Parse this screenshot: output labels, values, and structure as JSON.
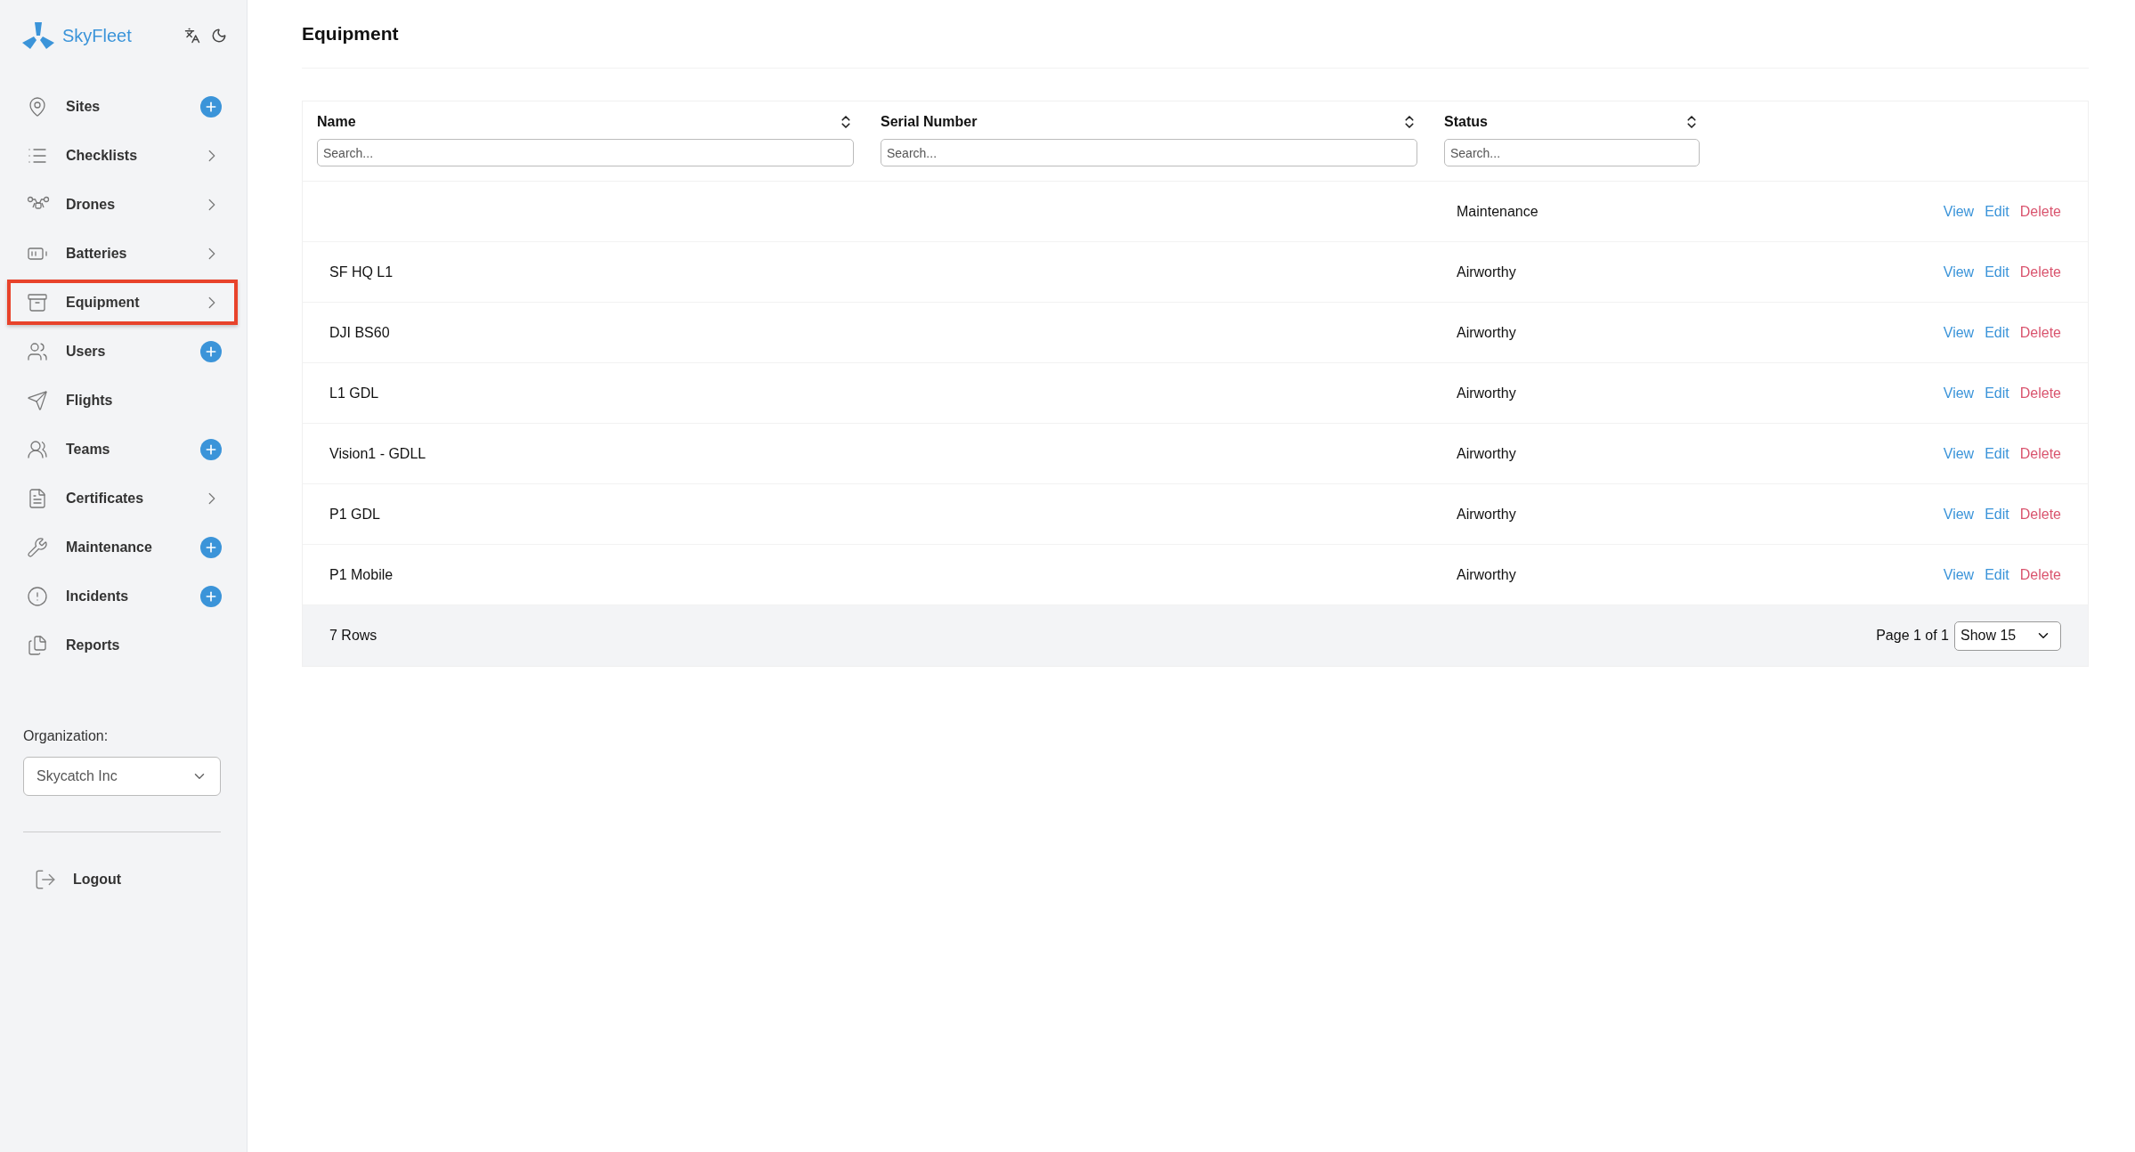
{
  "brand": {
    "name": "SkyFleet"
  },
  "sidebar": {
    "items": [
      {
        "label": "Sites",
        "kind": "add",
        "selected": false
      },
      {
        "label": "Checklists",
        "kind": "expand",
        "selected": false
      },
      {
        "label": "Drones",
        "kind": "expand",
        "selected": false
      },
      {
        "label": "Batteries",
        "kind": "expand",
        "selected": false
      },
      {
        "label": "Equipment",
        "kind": "expand",
        "selected": true
      },
      {
        "label": "Users",
        "kind": "add",
        "selected": false
      },
      {
        "label": "Flights",
        "kind": "plain",
        "selected": false
      },
      {
        "label": "Teams",
        "kind": "add",
        "selected": false
      },
      {
        "label": "Certificates",
        "kind": "expand",
        "selected": false
      },
      {
        "label": "Maintenance",
        "kind": "add",
        "selected": false
      },
      {
        "label": "Incidents",
        "kind": "add",
        "selected": false
      },
      {
        "label": "Reports",
        "kind": "plain",
        "selected": false
      }
    ],
    "organization": {
      "label": "Organization:",
      "value": "Skycatch Inc"
    },
    "logout": "Logout"
  },
  "page": {
    "title": "Equipment"
  },
  "table": {
    "columns": [
      {
        "label": "Name",
        "placeholder": "Search..."
      },
      {
        "label": "Serial Number",
        "placeholder": "Search..."
      },
      {
        "label": "Status",
        "placeholder": "Search..."
      }
    ],
    "rows": [
      {
        "status": "Maintenance",
        "actions": [
          {
            "label": "View",
            "kind": "link"
          },
          {
            "label": "Edit",
            "kind": "link"
          },
          {
            "label": "Delete",
            "kind": "danger"
          }
        ]
      },
      {
        "name": "SF HQ L1",
        "status": "Airworthy",
        "actions": [
          {
            "label": "View",
            "kind": "link"
          },
          {
            "label": "Edit",
            "kind": "link"
          },
          {
            "label": "Delete",
            "kind": "danger"
          }
        ]
      },
      {
        "name": "DJI BS60",
        "status": "Airworthy",
        "actions": [
          {
            "label": "View",
            "kind": "link"
          },
          {
            "label": "Edit",
            "kind": "link"
          },
          {
            "label": "Delete",
            "kind": "danger"
          }
        ]
      },
      {
        "name": "L1 GDL",
        "status": "Airworthy",
        "actions": [
          {
            "label": "View",
            "kind": "link"
          },
          {
            "label": "Edit",
            "kind": "link"
          },
          {
            "label": "Delete",
            "kind": "danger"
          }
        ]
      },
      {
        "name": "Vision1 - GDLL",
        "status": "Airworthy",
        "actions": [
          {
            "label": "View",
            "kind": "link"
          },
          {
            "label": "Edit",
            "kind": "link"
          },
          {
            "label": "Delete",
            "kind": "danger"
          }
        ]
      },
      {
        "name": "P1 GDL",
        "status": "Airworthy",
        "actions": [
          {
            "label": "View",
            "kind": "link"
          },
          {
            "label": "Edit",
            "kind": "link"
          },
          {
            "label": "Delete",
            "kind": "danger"
          }
        ]
      },
      {
        "name": "P1 Mobile",
        "status": "Airworthy",
        "actions": [
          {
            "label": "View",
            "kind": "link"
          },
          {
            "label": "Edit",
            "kind": "link"
          },
          {
            "label": "Delete",
            "kind": "danger"
          }
        ]
      }
    ],
    "footer": {
      "count": "7 Rows",
      "page": "Page 1 of 1",
      "page_size": "Show 15"
    }
  }
}
